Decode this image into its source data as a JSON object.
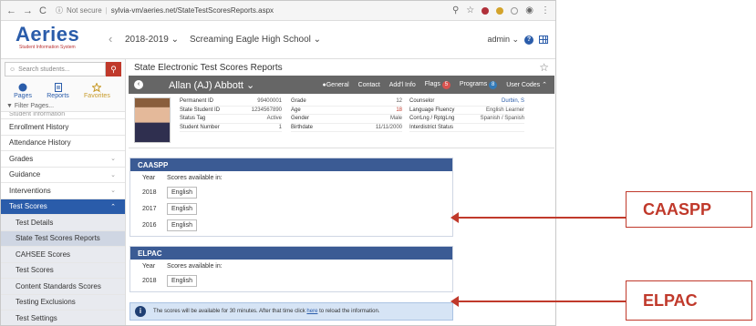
{
  "browser": {
    "security": "Not secure",
    "url": "sylvia-vm/aeries.net/StateTestScoresReports.aspx"
  },
  "app": {
    "logo": "Aeries",
    "logo_tagline": "Student Information System",
    "year": "2018-2019",
    "school": "Screaming Eagle High School",
    "user": "admin"
  },
  "sidebar": {
    "search_placeholder": "Search students...",
    "tabs": [
      "Pages",
      "Reports",
      "Favorites"
    ],
    "filter": "Filter Pages...",
    "cut_item": "Student Information",
    "items": [
      {
        "label": "Enrollment History",
        "chev": ""
      },
      {
        "label": "Attendance History",
        "chev": ""
      },
      {
        "label": "Grades",
        "chev": "⌄"
      },
      {
        "label": "Guidance",
        "chev": "⌄"
      },
      {
        "label": "Interventions",
        "chev": "⌄"
      },
      {
        "label": "Test Scores",
        "chev": "⌃"
      },
      {
        "label": "Test Details",
        "chev": ""
      },
      {
        "label": "State Test Scores Reports",
        "chev": ""
      },
      {
        "label": "CAHSEE Scores",
        "chev": ""
      },
      {
        "label": "Test Scores",
        "chev": ""
      },
      {
        "label": "Content Standards Scores",
        "chev": ""
      },
      {
        "label": "Testing Exclusions",
        "chev": ""
      },
      {
        "label": "Test Settings",
        "chev": ""
      }
    ]
  },
  "page": {
    "title": "State Electronic Test Scores Reports"
  },
  "student": {
    "name": "Allan (AJ) Abbott",
    "tabs": {
      "general": "General",
      "contact": "Contact",
      "addtl": "Add'l Info",
      "flags": "Flags",
      "flags_count": "5",
      "programs": "Programs",
      "programs_count": "8",
      "user_codes": "User Codes"
    },
    "col1": [
      {
        "k": "Permanent ID",
        "v": "99400001"
      },
      {
        "k": "State Student ID",
        "v": "1234567890"
      },
      {
        "k": "Status Tag",
        "v": "Active"
      },
      {
        "k": "Student Number",
        "v": "1"
      }
    ],
    "col2": [
      {
        "k": "Grade",
        "v": "12"
      },
      {
        "k": "Age",
        "v": "18"
      },
      {
        "k": "Gender",
        "v": "Male"
      },
      {
        "k": "Birthdate",
        "v": "11/11/2000"
      }
    ],
    "col3": [
      {
        "k": "Counselor",
        "v": "Durbin, S"
      },
      {
        "k": "Language Fluency",
        "v": "English Learner"
      },
      {
        "k": "CorrLng / RptgLng",
        "v": "Spanish / Spanish"
      },
      {
        "k": "Interdistrict Status",
        "v": ""
      }
    ]
  },
  "caaspp": {
    "title": "CAASPP",
    "col_year": "Year",
    "col_scores": "Scores available in:",
    "rows": [
      {
        "year": "2018",
        "btn": "English"
      },
      {
        "year": "2017",
        "btn": "English"
      },
      {
        "year": "2016",
        "btn": "English"
      }
    ]
  },
  "elpac": {
    "title": "ELPAC",
    "col_year": "Year",
    "col_scores": "Scores available in:",
    "rows": [
      {
        "year": "2018",
        "btn": "English"
      }
    ]
  },
  "notice": {
    "before": "The scores will be available for 30 minutes. After that time click ",
    "link": "here",
    "after": " to reload the information."
  },
  "callouts": {
    "caaspp": "CAASPP",
    "elpac": "ELPAC"
  },
  "colors": {
    "accent": "#2a5caa",
    "card_header": "#3b5b94",
    "callout": "#c0392b"
  }
}
